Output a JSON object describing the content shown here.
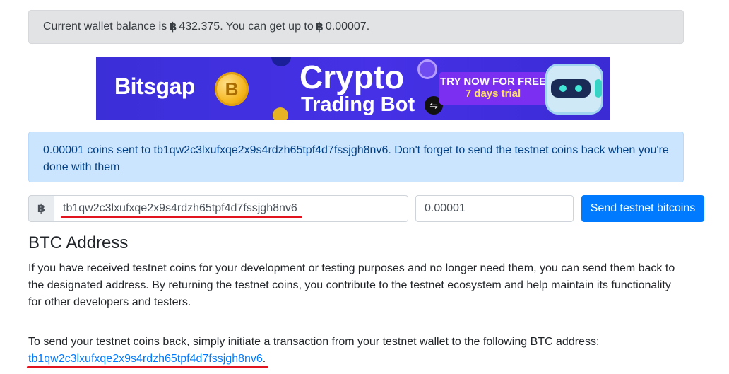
{
  "balance": {
    "prefix": "Current wallet balance is",
    "currency_symbol": "฿",
    "amount": "432.375",
    "middle": ". You can get up to",
    "max_amount": "0.00007",
    "suffix": "."
  },
  "banner": {
    "brand": "Bitsgap",
    "coin_symbol": "B",
    "title_line1": "Crypto",
    "title_line2": "Trading Bot",
    "cta_line1": "TRY NOW FOR FREE",
    "cta_line2": "7 days trial"
  },
  "alert": {
    "text": "0.00001 coins sent to tb1qw2c3lxufxqe2x9s4rdzh65tpf4d7fssjgh8nv6. Don't forget to send the testnet coins back when you're done with them"
  },
  "form": {
    "prepend_symbol": "฿",
    "address_value": "tb1qw2c3lxufxqe2x9s4rdzh65tpf4d7fssjgh8nv6",
    "amount_value": "0.00001",
    "send_label": "Send testnet bitcoins"
  },
  "section": {
    "title": "BTC Address",
    "paragraph1": "If you have received testnet coins for your development or testing purposes and no longer need them, you can send them back to the designated address. By returning the testnet coins, you contribute to the testnet ecosystem and help maintain its functionality for other developers and testers.",
    "paragraph2": "To send your testnet coins back, simply initiate a transaction from your testnet wallet to the following BTC address:",
    "return_address": "tb1qw2c3lxufxqe2x9s4rdzh65tpf4d7fssjgh8nv6",
    "return_suffix": "."
  },
  "colors": {
    "primary": "#007bff",
    "alert_info_bg": "#cce5ff",
    "secondary_bg": "#e2e3e5",
    "annotation_red": "#e0141e"
  }
}
